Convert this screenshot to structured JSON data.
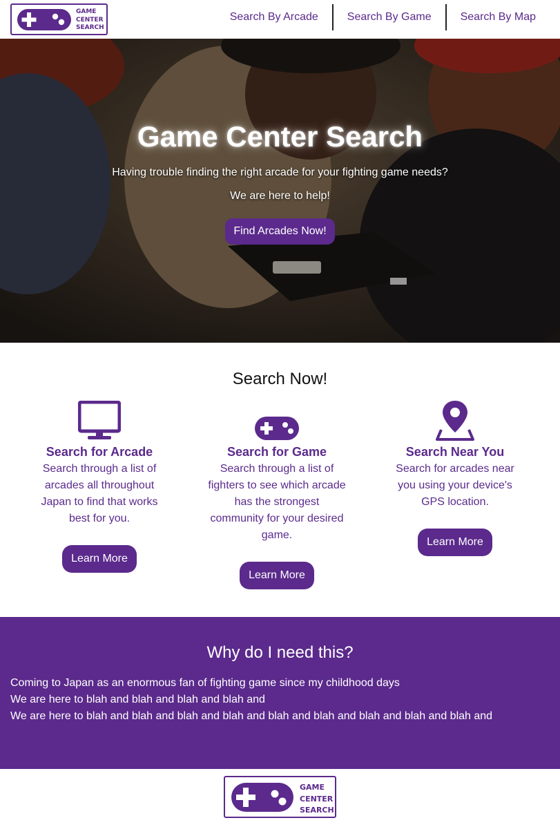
{
  "brand": {
    "logo_lines": [
      "GAME",
      "CENTER",
      "SEARCH"
    ],
    "color": "#5b2a8c"
  },
  "nav": {
    "items": [
      {
        "label": "Search By Arcade"
      },
      {
        "label": "Search By Game"
      },
      {
        "label": "Search By Map"
      }
    ]
  },
  "hero": {
    "title": "Game Center Search",
    "line1": "Having trouble finding the right arcade for your fighting game needs?",
    "line2": "We are here to help!",
    "cta_label": "Find Arcades Now!"
  },
  "search_now": {
    "title": "Search Now!",
    "features": [
      {
        "icon": "monitor-icon",
        "title": "Search for Arcade",
        "text": "Search through a list of arcades all throughout Japan to find that works best for you.",
        "button": "Learn More"
      },
      {
        "icon": "gamepad-icon",
        "title": "Search for Game",
        "text": "Search through a list of fighters to see which arcade has the strongest community for your desired game.",
        "button": "Learn More"
      },
      {
        "icon": "map-pin-icon",
        "title": "Search Near You",
        "text": "Search for arcades near you using your device's GPS location.",
        "button": "Learn More"
      }
    ]
  },
  "why": {
    "title": "Why do I need this?",
    "lines": [
      "Coming to Japan as an enormous fan of fighting game since my childhood days",
      "We are here to blah and blah and blah and blah and",
      "We are here to blah and blah and blah and blah and blah and blah and blah and blah and blah and"
    ]
  }
}
